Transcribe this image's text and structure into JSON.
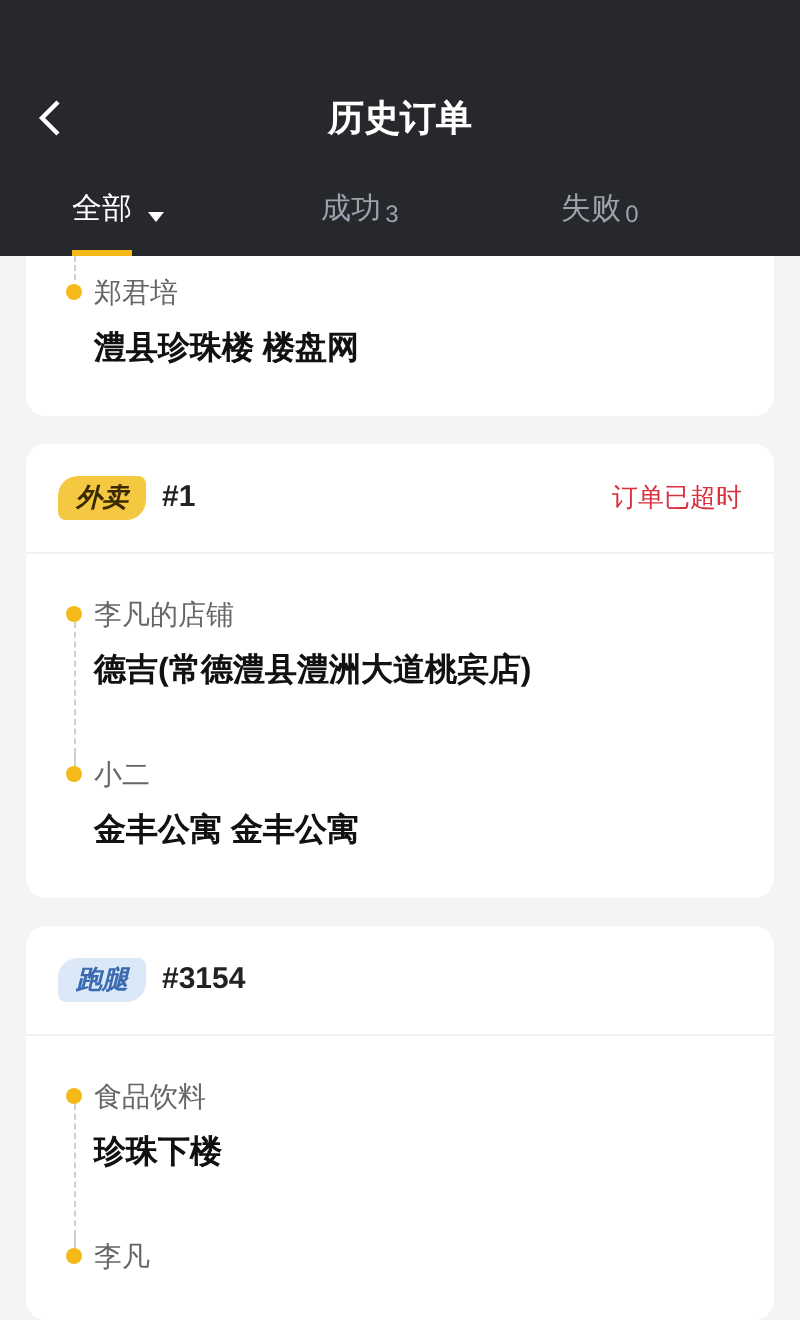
{
  "header": {
    "title": "历史订单"
  },
  "tabs": [
    {
      "label": "全部",
      "selected": true,
      "has_dropdown": true
    },
    {
      "label": "成功",
      "count": "3",
      "selected": false,
      "has_dropdown": false
    },
    {
      "label": "失败",
      "count": "0",
      "selected": false,
      "has_dropdown": false
    }
  ],
  "orders": [
    {
      "cut_top": true,
      "stops": [
        {
          "name": "郑君培",
          "address": "澧县珍珠楼 楼盘网"
        }
      ]
    },
    {
      "cut_top": false,
      "kind": "takeaway",
      "tag": "外卖",
      "number": "#1",
      "status": "订单已超时",
      "stops": [
        {
          "name": "李凡的店铺",
          "address": "德吉(常德澧县澧洲大道桃宾店)"
        },
        {
          "name": "小二",
          "address": "金丰公寓 金丰公寓"
        }
      ]
    },
    {
      "cut_top": false,
      "kind": "errand",
      "tag": "跑腿",
      "number": "#3154",
      "stops": [
        {
          "name": "食品饮料",
          "address": "珍珠下楼"
        },
        {
          "name": "李凡"
        }
      ]
    }
  ]
}
